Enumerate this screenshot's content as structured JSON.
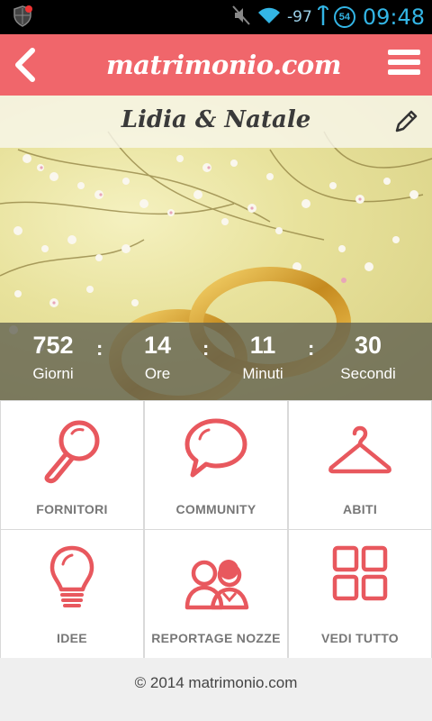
{
  "status_bar": {
    "signal_text": "-97",
    "badge_text": "54",
    "time": "09:48"
  },
  "header": {
    "logo_text": "matrimonio.com"
  },
  "hero": {
    "couple_name": "Lidia & Natale"
  },
  "countdown": [
    {
      "value": "752",
      "label": "Giorni"
    },
    {
      "value": "14",
      "label": "Ore"
    },
    {
      "value": "11",
      "label": "Minuti"
    },
    {
      "value": "30",
      "label": "Secondi"
    }
  ],
  "countdown_separator": ":",
  "tiles": [
    {
      "label": "FORNITORI",
      "icon": "magnifier-icon"
    },
    {
      "label": "COMMUNITY",
      "icon": "speech-bubble-icon"
    },
    {
      "label": "ABITI",
      "icon": "hanger-icon"
    },
    {
      "label": "IDEE",
      "icon": "lightbulb-icon"
    },
    {
      "label": "REPORTAGE NOZZE",
      "icon": "couple-icon"
    },
    {
      "label": "VEDI TUTTO",
      "icon": "grid-icon"
    }
  ],
  "footer": {
    "copyright": "© 2014 matrimonio.com"
  },
  "colors": {
    "brand": "#f0666b",
    "icon_accent": "#e8585e",
    "status_blue": "#33b5e5"
  }
}
